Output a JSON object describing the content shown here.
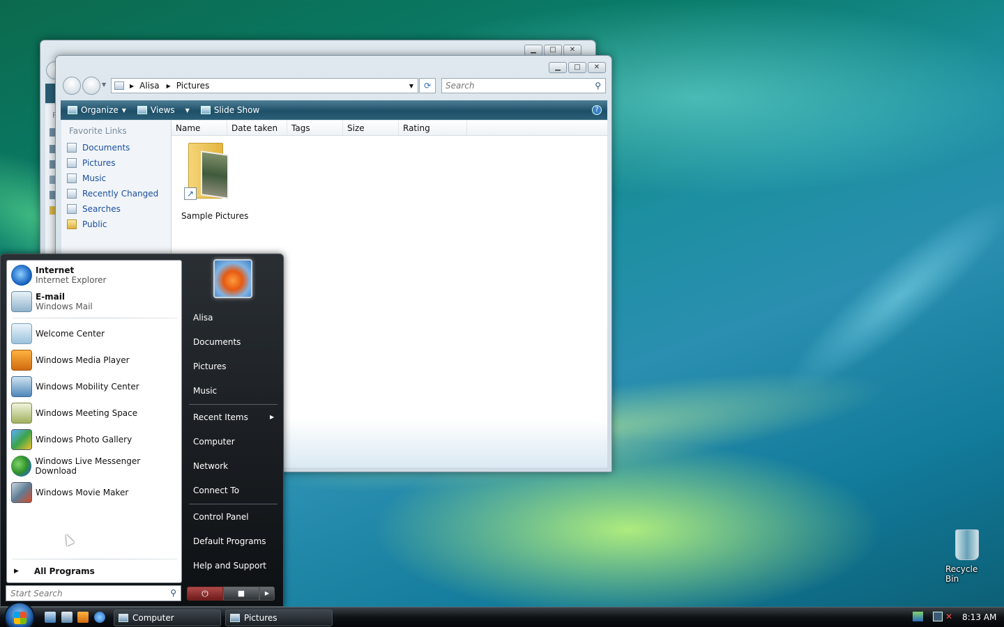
{
  "desktop": {
    "recycle_bin_label": "Recycle Bin"
  },
  "back_window": {
    "letters": "F"
  },
  "explorer": {
    "breadcrumb": [
      "Alisa",
      "Pictures"
    ],
    "search_placeholder": "Search",
    "toolbar": {
      "organize": "Organize",
      "views": "Views",
      "slideshow": "Slide Show"
    },
    "favorite_links_header": "Favorite Links",
    "favorite_links": [
      "Documents",
      "Pictures",
      "Music",
      "Recently Changed",
      "Searches",
      "Public"
    ],
    "columns": [
      "Name",
      "Date taken",
      "Tags",
      "Size",
      "Rating"
    ],
    "items": [
      {
        "name": "Sample Pictures",
        "icon": "folder-shortcut-icon"
      }
    ]
  },
  "start_menu": {
    "pinned": [
      {
        "title": "Internet",
        "subtitle": "Internet Explorer",
        "icon": "ie-icon"
      },
      {
        "title": "E-mail",
        "subtitle": "Windows Mail",
        "icon": "mail-icon"
      }
    ],
    "recent": [
      {
        "label": "Welcome Center",
        "icon": "welcome-center-icon"
      },
      {
        "label": "Windows Media Player",
        "icon": "media-player-icon"
      },
      {
        "label": "Windows Mobility Center",
        "icon": "mobility-center-icon"
      },
      {
        "label": "Windows Meeting Space",
        "icon": "meeting-space-icon"
      },
      {
        "label": "Windows Photo Gallery",
        "icon": "photo-gallery-icon"
      },
      {
        "label": "Windows Live Messenger Download",
        "icon": "messenger-icon"
      },
      {
        "label": "Windows Movie Maker",
        "icon": "movie-maker-icon"
      }
    ],
    "all_programs": "All Programs",
    "search_placeholder": "Start Search",
    "right": {
      "user": "Alisa",
      "group1": [
        "Documents",
        "Pictures",
        "Music"
      ],
      "group2": [
        "Recent Items",
        "Computer",
        "Network",
        "Connect To"
      ],
      "group3": [
        "Control Panel",
        "Default Programs",
        "Help and Support"
      ]
    }
  },
  "taskbar": {
    "buttons": [
      "Computer",
      "Pictures"
    ],
    "clock": "8:13 AM"
  }
}
